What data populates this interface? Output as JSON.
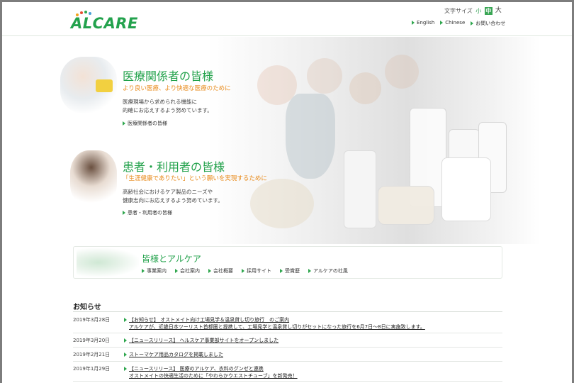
{
  "header": {
    "logo_text": "ALCARE",
    "font_size_label": "文字サイズ",
    "font_size_small": "小",
    "font_size_medium": "中",
    "font_size_large": "大",
    "links": [
      "English",
      "Chinese",
      "お問い合わせ"
    ]
  },
  "medical": {
    "title": "医療関係者の皆様",
    "subtitle": "より良い医療、より快適な医療のために",
    "body_line1": "医療現場から求められる機能に",
    "body_line2": "的確にお応えするよう努めています。",
    "link": "医療関係者の皆様"
  },
  "patients": {
    "title": "患者・利用者の皆様",
    "subtitle": "「生涯健康でありたい」という願いを実現するために",
    "body_line1": "高齢社会におけるケア製品のニーズや",
    "body_line2": "健康志向にお応えするよう努めています。",
    "link": "患者・利用者の皆様"
  },
  "company": {
    "title": "皆様とアルケア",
    "links": [
      "事業案内",
      "会社案内",
      "会社概要",
      "採用サイト",
      "受賞歴",
      "アルケアの社風"
    ]
  },
  "news": {
    "title": "お知らせ",
    "items": [
      {
        "date": "2019年3月28日",
        "line1": "【お知らせ】 オストメイト向け工場見学＆温泉貸し切り旅行　のご案内",
        "line2": "アルケアが、近畿日本ツーリスト首都圏と提携して、工場見学と温泉貸し切りがセットになった旅行を6月7日～8日に実施致します。"
      },
      {
        "date": "2019年3月20日",
        "line1": "【ニュースリリース】 ヘルスケア事業部サイトをオープンしました",
        "line2": ""
      },
      {
        "date": "2019年2月21日",
        "line1": "ストーマケア用品カタログを掲載しました",
        "line2": ""
      },
      {
        "date": "2019年1月29日",
        "line1": "【ニュースリリース】 医療のアルケア、衣料のグンゼと連携",
        "line2": "オストメイトの快適生活のために「やわらかウエストチューブ」を新発売！"
      }
    ]
  },
  "colors": {
    "brand_green": "#23a24d",
    "accent_orange": "#e88a1a",
    "frame_gray": "#7d7d7d"
  }
}
